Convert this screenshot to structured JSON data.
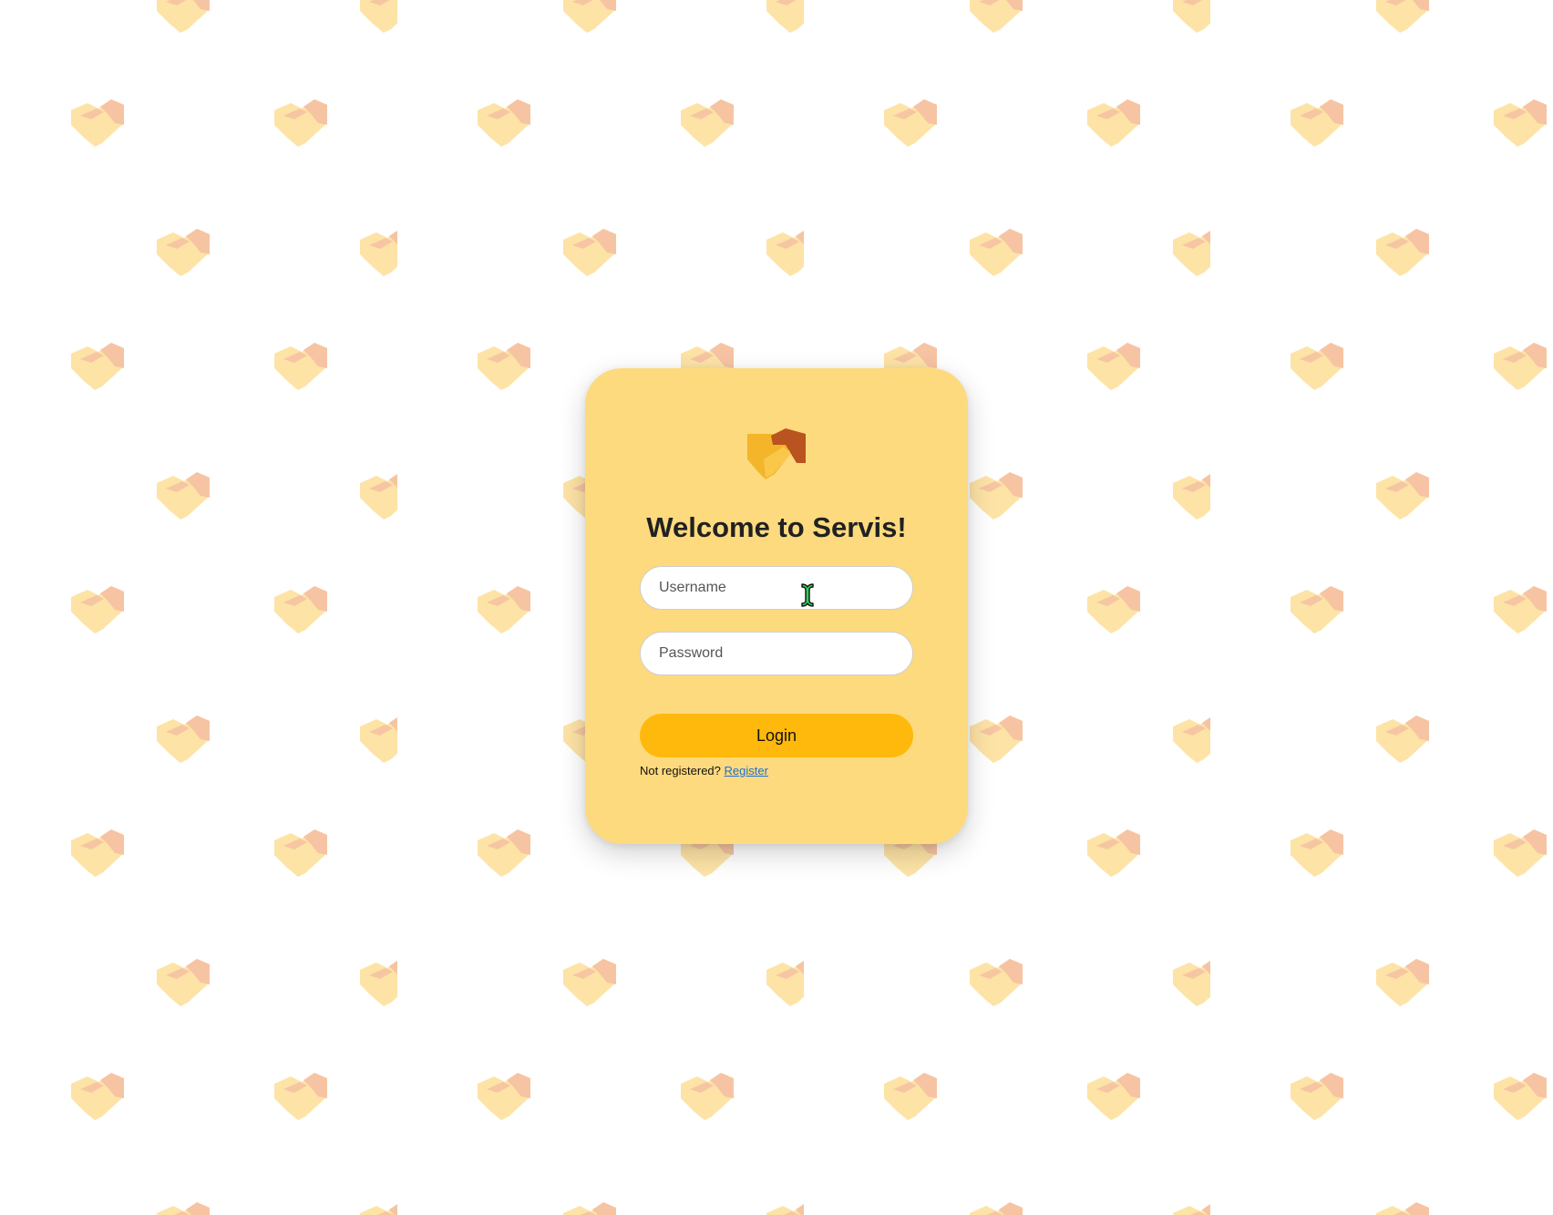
{
  "login": {
    "title": "Welcome to Servis!",
    "username_placeholder": "Username",
    "password_placeholder": "Password",
    "login_label": "Login",
    "register_prompt": "Not registered?",
    "register_link": "Register"
  },
  "icons": {
    "logo": "handshake-icon",
    "background": "handshake-icon",
    "cursor": "text-cursor-icon"
  },
  "colors": {
    "card": "#fdda7e",
    "button": "#ffb90c",
    "link": "#1f6fd6",
    "pattern_left": "#fde3a6",
    "pattern_right": "#f6c4a3",
    "logo_dark": "#b9531f",
    "logo_light": "#f4b52a"
  }
}
